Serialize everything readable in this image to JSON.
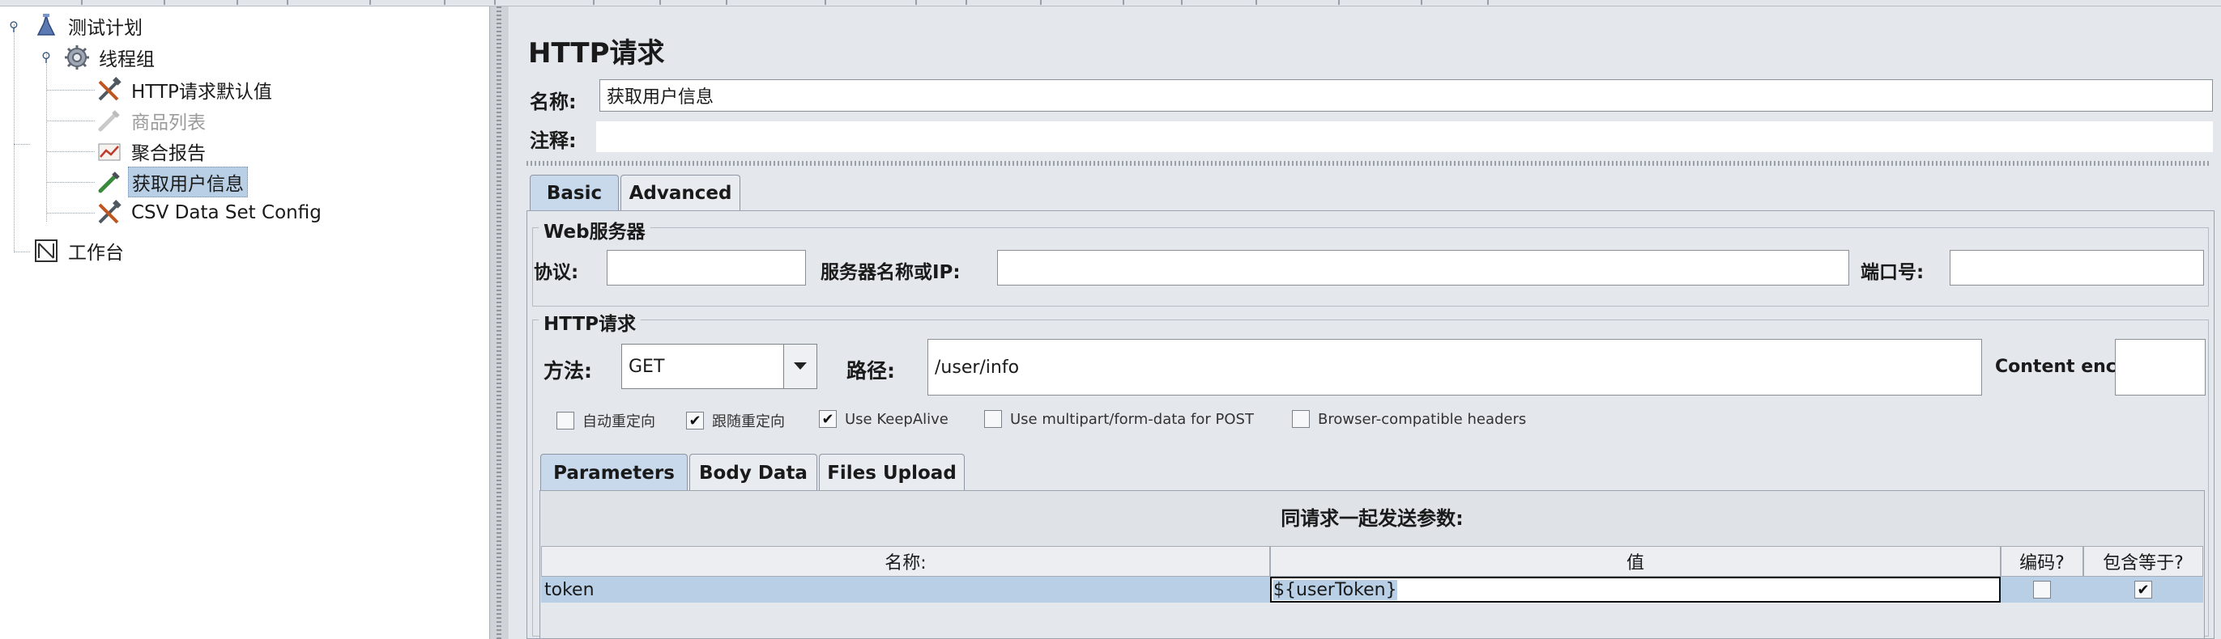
{
  "tree": {
    "items": [
      {
        "label": "测试计划",
        "icon": "test-plan-icon"
      },
      {
        "label": "线程组",
        "icon": "thread-group-gear-icon"
      },
      {
        "label": "HTTP请求默认值",
        "icon": "config-tools-icon"
      },
      {
        "label": "商品列表",
        "icon": "sampler-pipette-icon",
        "disabled": true
      },
      {
        "label": "聚合报告",
        "icon": "report-chart-icon"
      },
      {
        "label": "获取用户信息",
        "icon": "sampler-pipette-icon",
        "selected": true
      },
      {
        "label": "CSV Data Set Config",
        "icon": "config-tools-icon"
      },
      {
        "label": "工作台",
        "icon": "workbench-icon"
      }
    ]
  },
  "main": {
    "title": "HTTP请求",
    "name_label": "名称:",
    "name_value": "获取用户信息",
    "comment_label": "注释:",
    "comment_value": "",
    "tabs": [
      {
        "label": "Basic",
        "active": true
      },
      {
        "label": "Advanced",
        "active": false
      }
    ],
    "web_server": {
      "title": "Web服务器",
      "protocol_label": "协议:",
      "protocol_value": "",
      "server_label": "服务器名称或IP:",
      "server_value": "",
      "port_label": "端口号:",
      "port_value": ""
    },
    "http_request": {
      "title": "HTTP请求",
      "method_label": "方法:",
      "method_value": "GET",
      "path_label": "路径:",
      "path_value": "/user/info",
      "encoding_label": "Content encoding:",
      "encoding_value": ""
    },
    "options": [
      {
        "label": "自动重定向",
        "checked": false
      },
      {
        "label": "跟随重定向",
        "checked": true
      },
      {
        "label": "Use KeepAlive",
        "checked": true
      },
      {
        "label": "Use multipart/form-data for POST",
        "checked": false
      },
      {
        "label": "Browser-compatible headers",
        "checked": false
      }
    ],
    "sub_tabs": [
      {
        "label": "Parameters",
        "active": true
      },
      {
        "label": "Body Data",
        "active": false
      },
      {
        "label": "Files Upload",
        "active": false
      }
    ],
    "params": {
      "caption": "同请求一起发送参数:",
      "columns": [
        "名称:",
        "值",
        "编码?",
        "包含等于?"
      ],
      "rows": [
        {
          "name": "token",
          "value": "${userToken}",
          "encode": false,
          "include_equals": true
        }
      ]
    }
  },
  "colors": {
    "selection": "#b8cfe5",
    "panel": "#e4e7ec",
    "active_tab": "#c8d9ec"
  }
}
